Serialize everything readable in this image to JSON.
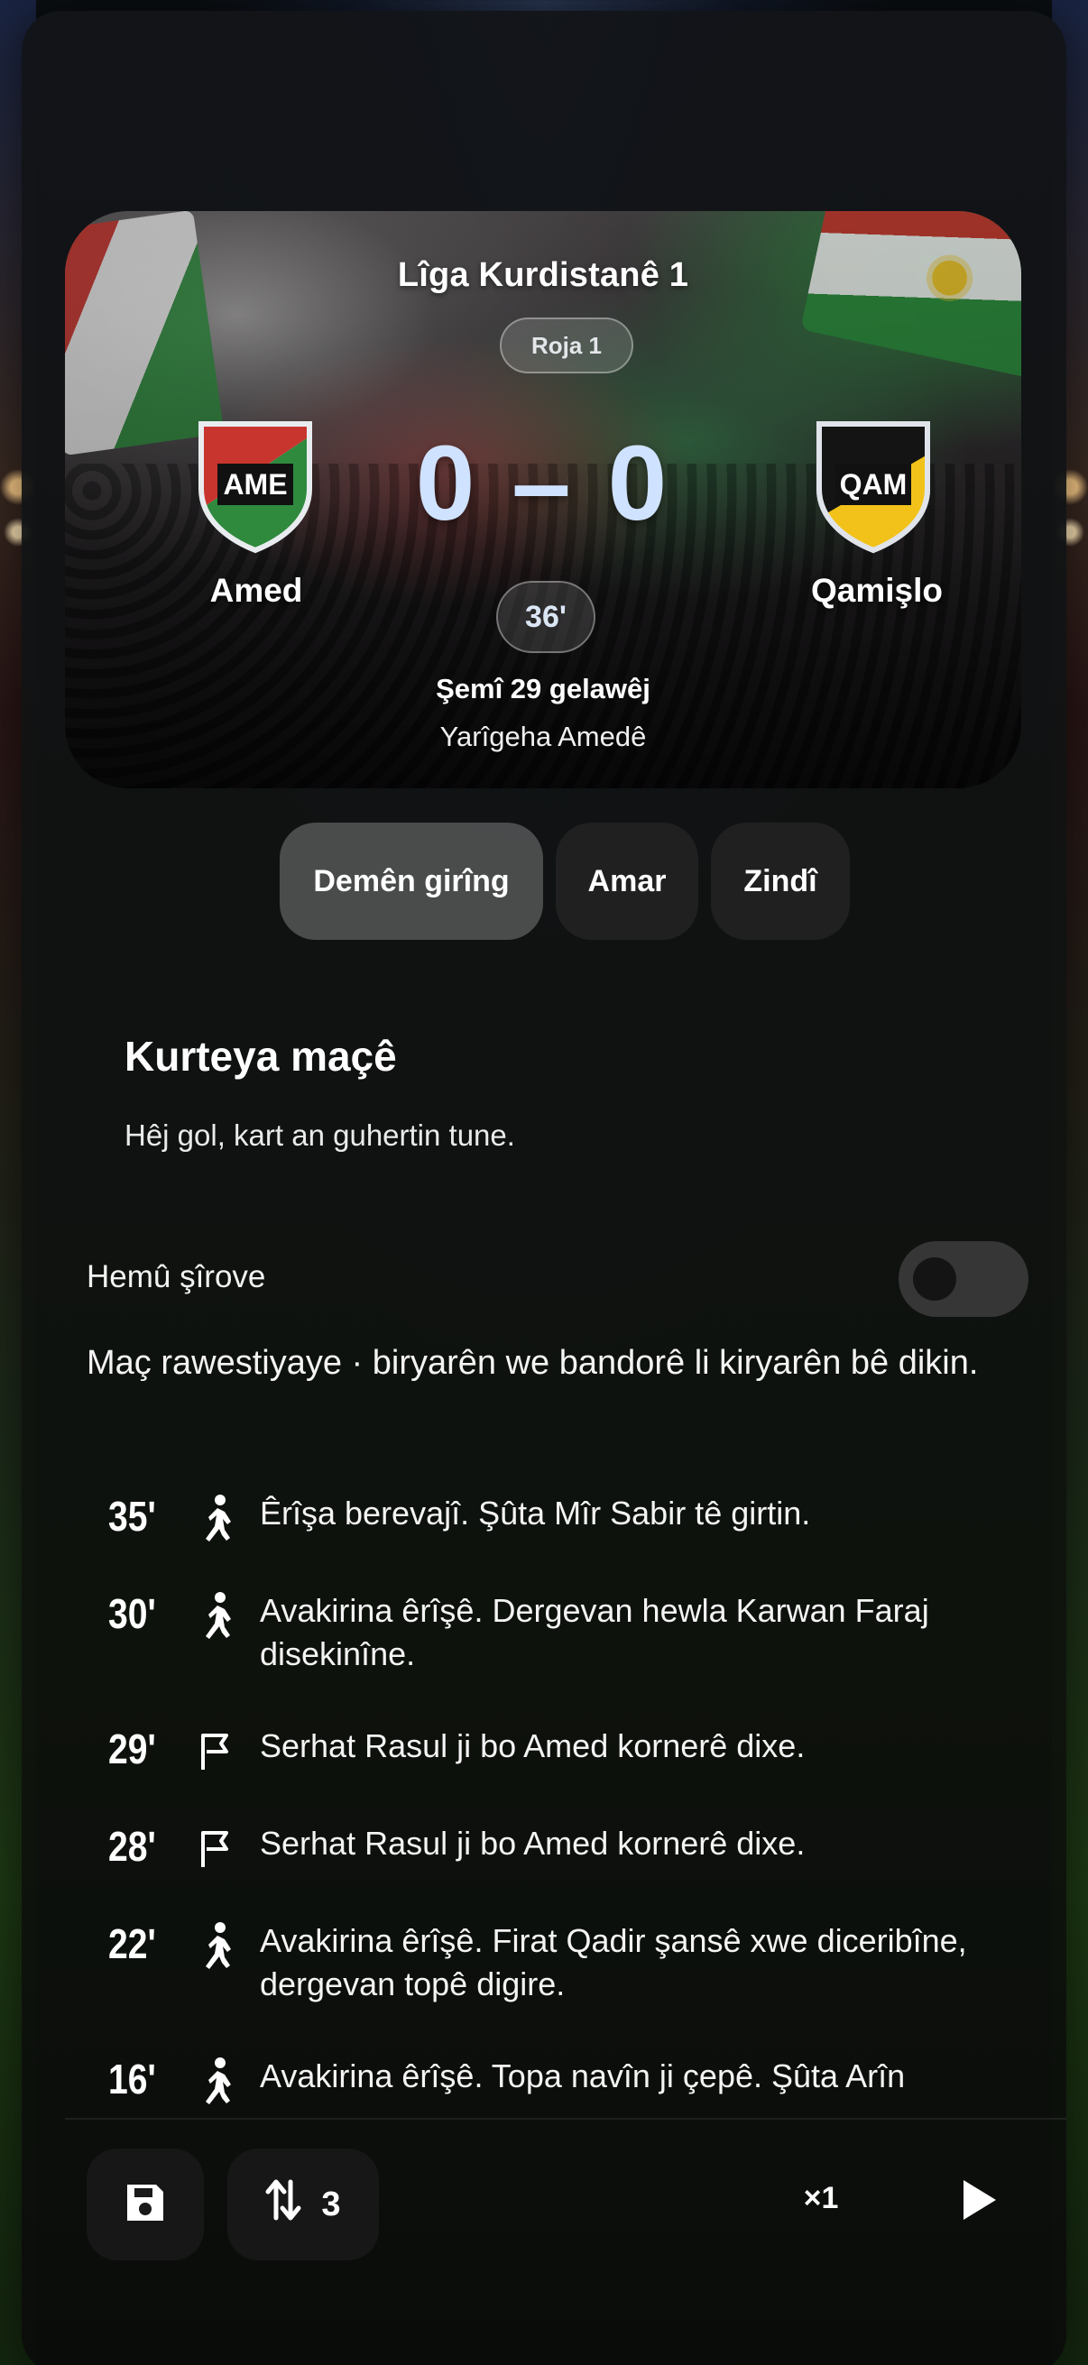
{
  "match": {
    "league": "Lîga Kurdistanê 1",
    "round": "Roja 1",
    "home_team": {
      "name": "Amed",
      "crest_text": "AME"
    },
    "away_team": {
      "name": "Qamişlo",
      "crest_text": "QAM"
    },
    "score": "0 – 0",
    "minute": "36'",
    "date": "Şemî 29 gelawêj",
    "venue": "Yarîgeha Amedê"
  },
  "tabs": [
    {
      "label": "Demên girîng",
      "active": true
    },
    {
      "label": "Amar",
      "active": false
    },
    {
      "label": "Zindî",
      "active": false
    }
  ],
  "summary": {
    "title": "Kurteya maçê",
    "text": "Hêj gol, kart an guhertin tune."
  },
  "commentary_toggle": {
    "label": "Hemû şîrove",
    "on": false
  },
  "status_text": "Maç rawestiyaye · biryarên we bandorê li kiryarên bê dikin.",
  "commentary": [
    {
      "minute": "35'",
      "icon": "running-icon",
      "text": "Êrîşa berevajî. Şûta Mîr Sabir tê girtin."
    },
    {
      "minute": "30'",
      "icon": "running-icon",
      "text": "Avakirina êrîşê. Dergevan hewla Karwan Faraj disekinîne."
    },
    {
      "minute": "29'",
      "icon": "corner-flag-icon",
      "text": "Serhat Rasul ji bo Amed kornerê dixe."
    },
    {
      "minute": "28'",
      "icon": "corner-flag-icon",
      "text": "Serhat Rasul ji bo Amed kornerê dixe."
    },
    {
      "minute": "22'",
      "icon": "running-icon",
      "text": "Avakirina êrîşê. Firat Qadir şansê xwe diceribîne, dergevan topê digire."
    },
    {
      "minute": "16'",
      "icon": "running-icon",
      "text": "Avakirina êrîşê. Topa navîn ji çepê. Şûta Arîn"
    }
  ],
  "bottom_bar": {
    "substitutions_count": "3",
    "speed_label": "×1"
  },
  "colors": {
    "score": "#cfe2ff",
    "home_crest_red": "#c8352e",
    "home_crest_green": "#2f8a3e",
    "away_crest_yellow": "#f2c21a"
  }
}
